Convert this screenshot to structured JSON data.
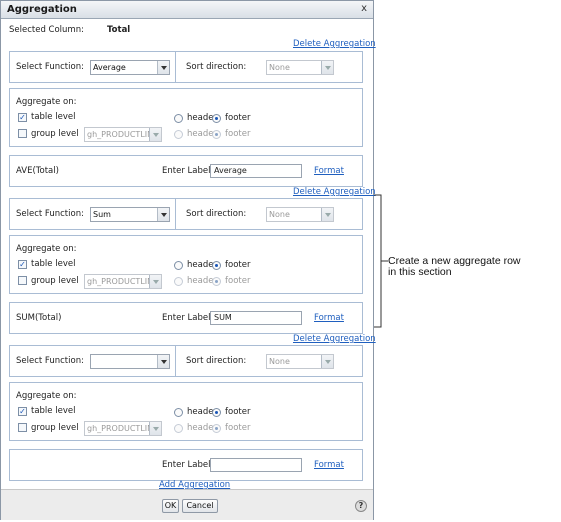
{
  "dialog": {
    "title": "Aggregation",
    "close": "x",
    "selected_column_label": "Selected Column:",
    "selected_column_value": "Total"
  },
  "delete_link": "Delete Aggregation",
  "select_function_label": "Select Function:",
  "sort_direction_label": "Sort direction:",
  "aggregate_on_label": "Aggregate on:",
  "table_level_label": "table level",
  "group_level_label": "group level",
  "header_label": "header",
  "footer_label": "footer",
  "enter_label": "Enter Label:",
  "format_link": "Format",
  "aggregations": [
    {
      "function": "Average",
      "sort": "None",
      "group": "gh_PRODUCTLIN",
      "expr": "AVE(Total)",
      "label": "Average"
    },
    {
      "function": "Sum",
      "sort": "None",
      "group": "gh_PRODUCTLIN",
      "expr": "SUM(Total)",
      "label": "SUM"
    },
    {
      "function": "",
      "sort": "None",
      "group": "gh_PRODUCTLIN",
      "expr": "",
      "label": ""
    }
  ],
  "add_aggregation": "Add Aggregation",
  "ok": "OK",
  "cancel": "Cancel",
  "help": "?",
  "annotation": {
    "line1": "Create a new aggregate row",
    "line2": "in this section"
  }
}
